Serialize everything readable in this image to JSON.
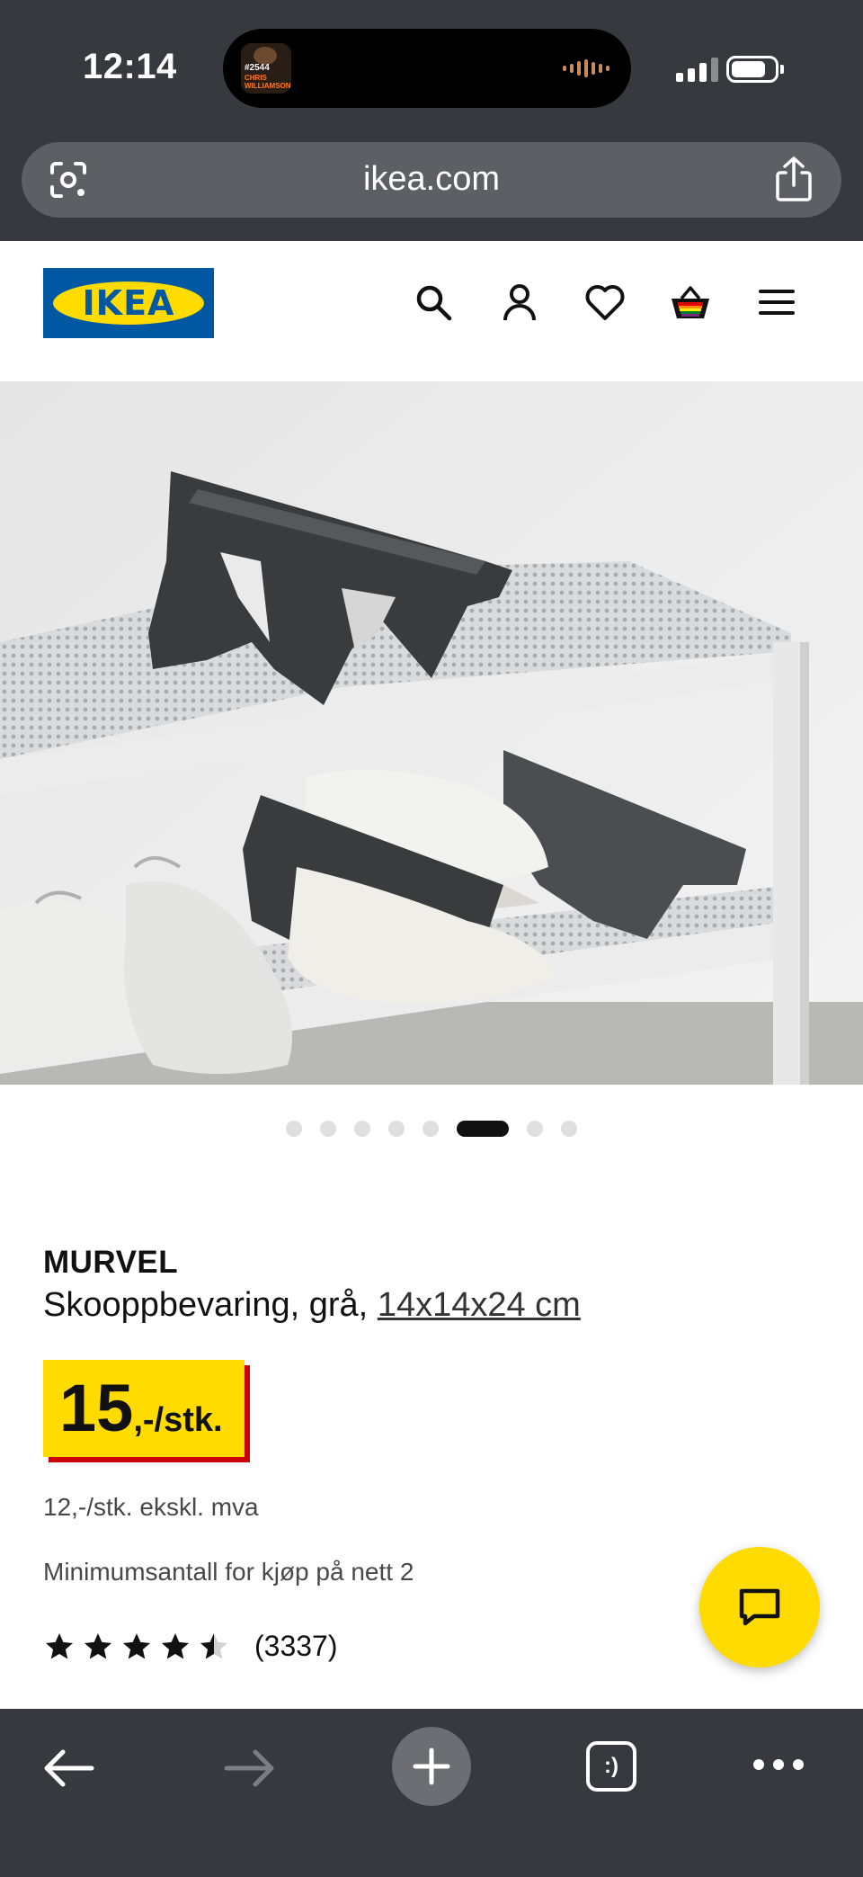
{
  "status_bar": {
    "time": "12:14",
    "now_playing": {
      "episode": "#2544",
      "guest": "CHRIS WILLIAMSON"
    }
  },
  "browser": {
    "url": "ikea.com"
  },
  "header": {
    "logo_text": "IKEA",
    "icons": [
      "search-icon",
      "account-icon",
      "heart-icon",
      "basket-icon",
      "menu-icon"
    ]
  },
  "carousel": {
    "total": 8,
    "active_index": 5
  },
  "product": {
    "name": "MURVEL",
    "description": "Skooppbevaring, grå, ",
    "size": "14x14x24 cm",
    "price_main": "15",
    "price_suffix": ",-/stk.",
    "price_excl_vat": "12,-/stk. ekskl. mva",
    "min_quantity": "Minimumsantall for kjøp på nett 2",
    "rating": 4.5,
    "rating_max": 5,
    "review_count": "(3337)"
  },
  "colors": {
    "ikea_blue": "#0058a3",
    "ikea_yellow": "#ffdb00",
    "price_shadow_red": "#cc0008",
    "chrome_dark": "#36393d"
  },
  "bottom_bar": {
    "tabs_label": ":)"
  }
}
